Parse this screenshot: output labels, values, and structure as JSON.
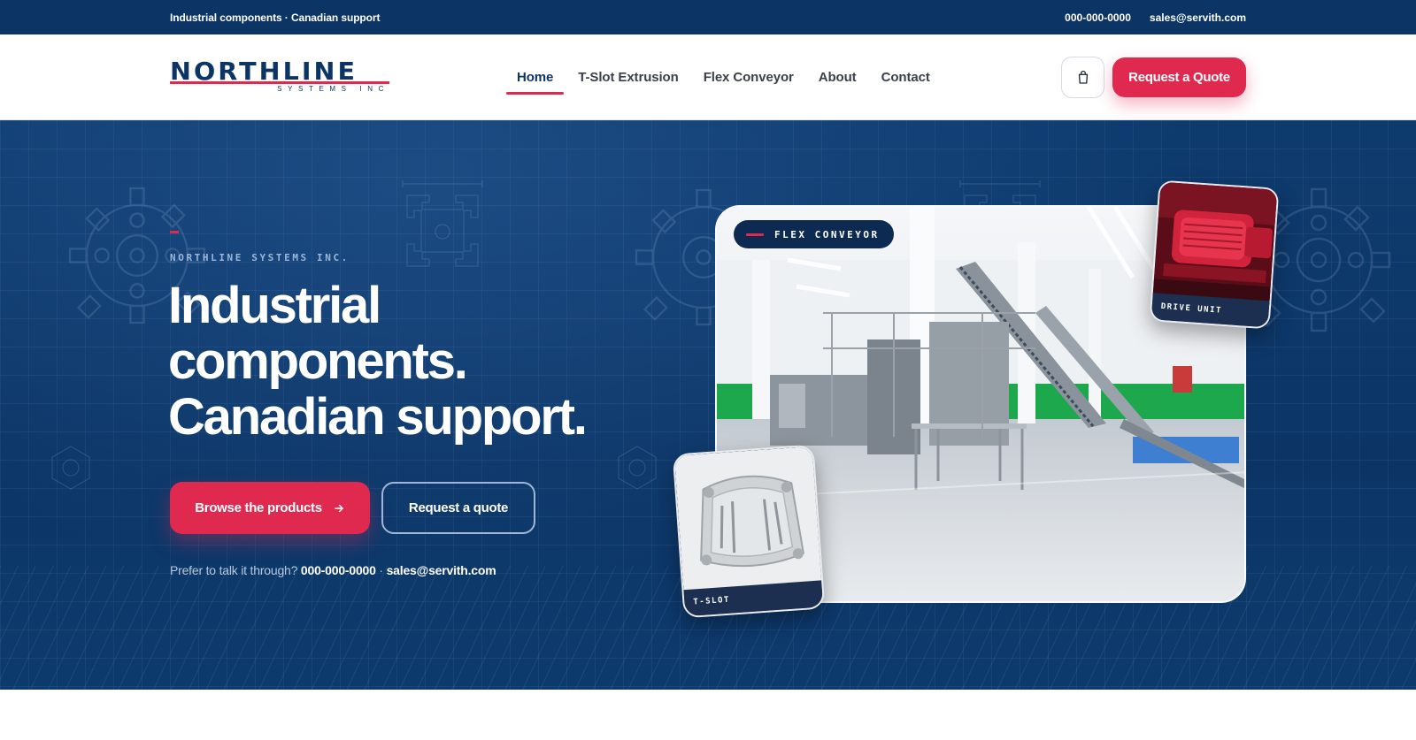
{
  "topbar": {
    "tagline": "Industrial components · Canadian support",
    "phone": "000-000-0000",
    "email": "sales@servith.com"
  },
  "header": {
    "logo": {
      "word": "NORTHLINE",
      "sub": "SYSTEMS INC"
    },
    "nav": [
      {
        "label": "Home",
        "active": true
      },
      {
        "label": "T-Slot Extrusion",
        "active": false
      },
      {
        "label": "Flex Conveyor",
        "active": false
      },
      {
        "label": "About",
        "active": false
      },
      {
        "label": "Contact",
        "active": false
      }
    ],
    "cart_icon": "shopping-bag-icon",
    "quote_button": "Request a Quote"
  },
  "hero": {
    "eyebrow": "NORTHLINE SYSTEMS INC.",
    "headline": [
      "Industrial",
      "components.",
      "Canadian support."
    ],
    "primary_button": "Browse the products",
    "primary_icon": "arrow-right-icon",
    "secondary_button": "Request a quote",
    "talk_prefix": "Prefer to talk it through?",
    "talk_phone": "000-000-0000",
    "talk_separator": "·",
    "talk_email": "sales@servith.com",
    "main_chip": "FLEX CONVEYOR",
    "card_drive": "DRIVE UNIT",
    "card_tslot": "T-SLOT"
  },
  "colors": {
    "navy": "#0c3566",
    "accent": "#e0294f",
    "white": "#ffffff"
  }
}
